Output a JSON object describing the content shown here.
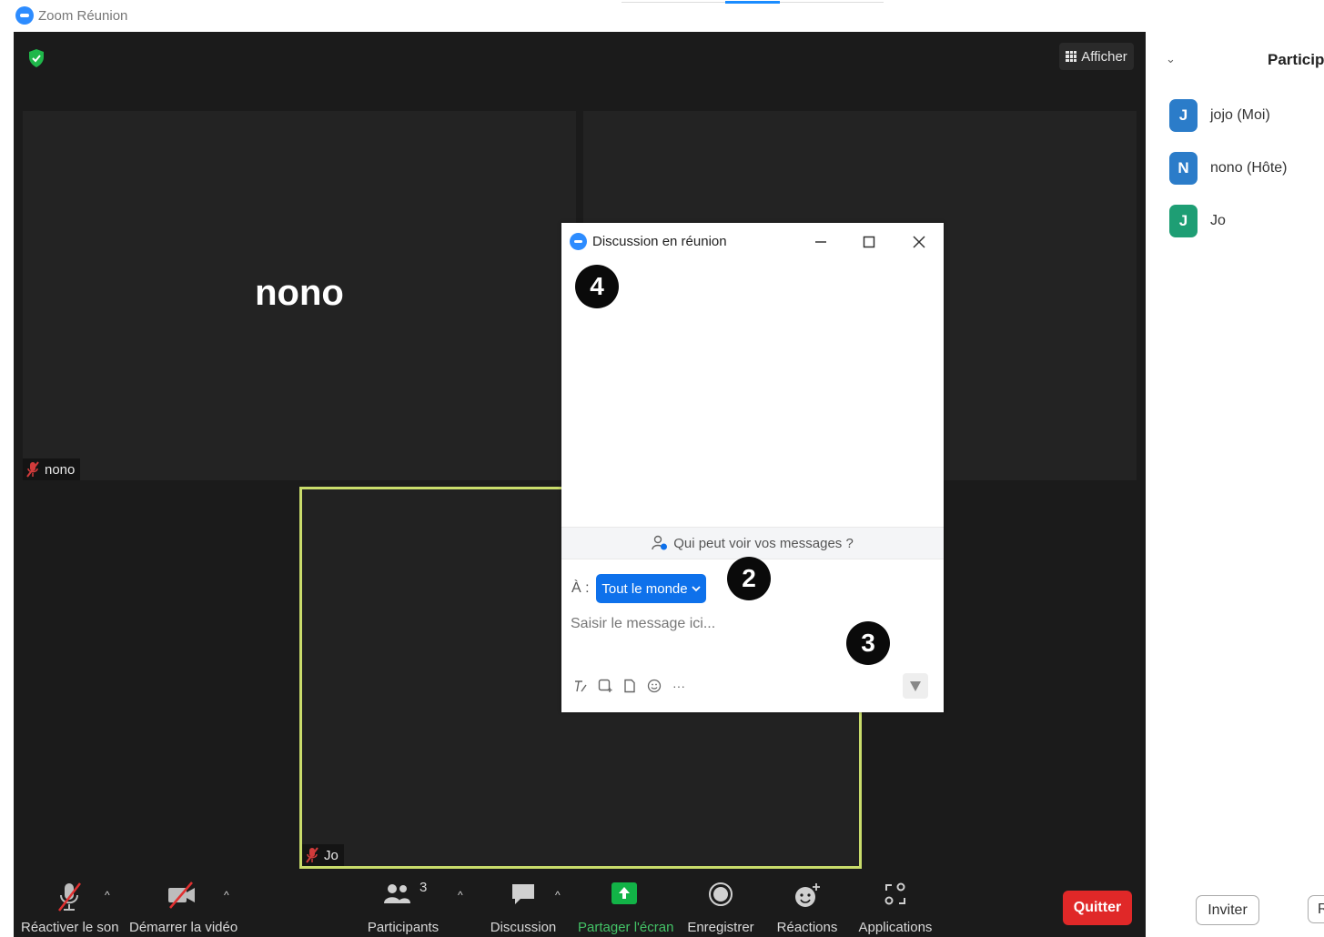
{
  "window": {
    "title": "Zoom Réunion"
  },
  "meeting": {
    "view_button": "Afficher",
    "tiles": [
      {
        "display_name": "nono",
        "label": "nono"
      },
      {
        "label": "Jo"
      }
    ]
  },
  "toolbar": {
    "unmute": "Réactiver le son",
    "start_video": "Démarrer la vidéo",
    "participants": "Participants",
    "participants_count": "3",
    "chat": "Discussion",
    "share": "Partager l'écran",
    "record": "Enregistrer",
    "reactions": "Réactions",
    "apps": "Applications",
    "quit": "Quitter"
  },
  "chat": {
    "title": "Discussion en réunion",
    "who_can_see": "Qui peut voir vos messages ?",
    "to_label": "À :",
    "recipient": "Tout le monde",
    "placeholder": "Saisir le message ici..."
  },
  "badges": [
    "4",
    "2",
    "3"
  ],
  "panel": {
    "title": "Participants",
    "participants": [
      {
        "initial": "J",
        "name": "jojo (Moi)",
        "color": "#2b7cc9"
      },
      {
        "initial": "N",
        "name": "nono (Hôte)",
        "color": "#2b7cc9"
      },
      {
        "initial": "J",
        "name": "Jo",
        "color": "#1e9e74"
      }
    ],
    "invite": "Inviter",
    "more": "R"
  }
}
